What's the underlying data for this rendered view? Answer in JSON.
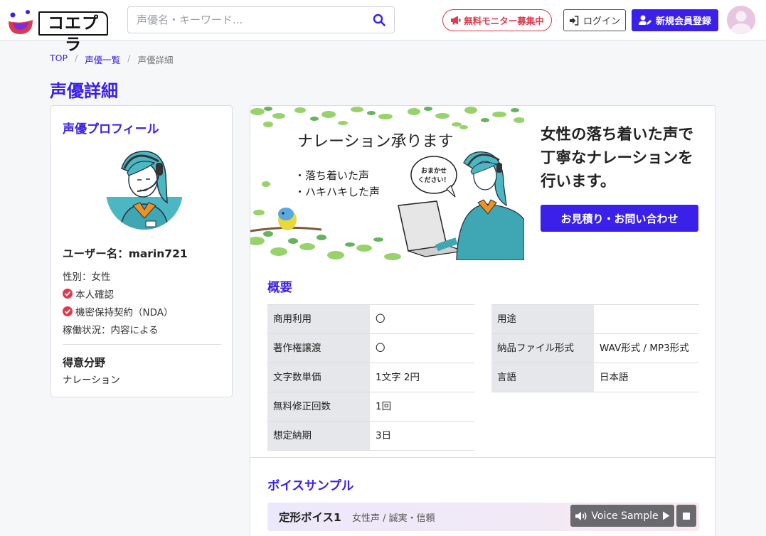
{
  "header": {
    "logo_text": "コエプラ",
    "search_placeholder": "声優名・キーワード...",
    "monitor_label": "無料モニター募集中",
    "login_label": "ログイン",
    "register_label": "新規会員登録",
    "icons": [
      "logo-face-icon",
      "search-icon",
      "megaphone-icon",
      "login-icon",
      "user-edit-icon",
      "avatar-icon"
    ]
  },
  "breadcrumb": [
    "TOP",
    "声優一覧",
    "声優詳細"
  ],
  "page_title": "声優詳細",
  "profile": {
    "heading": "声優プロフィール",
    "username": "ユーザー名：marin721",
    "gender": "性別：女性",
    "identity": "本人確認",
    "nda": "機密保持契約（NDA）",
    "status": "稼働状況：内容による",
    "specialty_heading": "得意分野",
    "specialty": "ナレーション"
  },
  "banner": {
    "title": "ナレーション承ります",
    "line1": "・落ち着いた声",
    "line2": "・ハキハキした声",
    "bubble1": "おまかせ",
    "bubble2": "ください！"
  },
  "catch_copy": "女性の落ち着いた声で丁寧なナレーションを行います。",
  "contact_label": "お見積り・お問い合わせ",
  "overview": {
    "heading": "概要",
    "left": [
      {
        "k": "商用利用",
        "v": "〇"
      },
      {
        "k": "著作権譲渡",
        "v": "〇"
      },
      {
        "k": "文字数単価",
        "v": "1文字 2円"
      },
      {
        "k": "無料修正回数",
        "v": "1回"
      },
      {
        "k": "想定納期",
        "v": "3日"
      }
    ],
    "right": [
      {
        "k": "用途",
        "v": ""
      },
      {
        "k": "納品ファイル形式",
        "v": "WAV形式 / MP3形式"
      },
      {
        "k": "言語",
        "v": "日本語"
      }
    ]
  },
  "voice": {
    "heading": "ボイスサンプル",
    "title": "定形ボイス1",
    "tags": "女性声 / 誠実・信頼",
    "player_label": "Voice Sample"
  },
  "colors": {
    "accent": "#3a20e8",
    "alert": "#e0384c",
    "table_key_bg": "#e6e7ea"
  }
}
